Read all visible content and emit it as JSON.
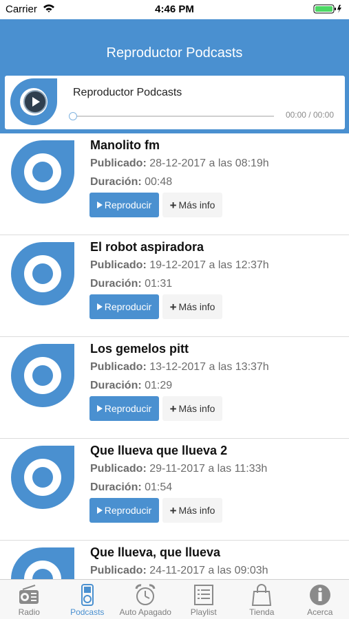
{
  "status_bar": {
    "carrier": "Carrier",
    "time": "4:46 PM"
  },
  "header": {
    "title": "Reproductor Podcasts"
  },
  "player": {
    "title": "Reproductor Podcasts",
    "time": "00:00 / 00:00",
    "progress": 0
  },
  "labels": {
    "published": "Publicado:",
    "duration": "Duración:",
    "play": "Reproducir",
    "more_info": "Más info"
  },
  "podcasts": [
    {
      "title": "Manolito fm",
      "published": "28-12-2017 a las 08:19h",
      "duration": "00:48"
    },
    {
      "title": "El robot aspiradora",
      "published": "19-12-2017 a las 12:37h",
      "duration": "01:31"
    },
    {
      "title": "Los gemelos pitt",
      "published": "13-12-2017 a las 13:37h",
      "duration": "01:29"
    },
    {
      "title": "Que llueva que llueva 2",
      "published": "29-11-2017 a las 11:33h",
      "duration": "01:54"
    },
    {
      "title": "Que llueva, que llueva",
      "published": "24-11-2017 a las 09:03h",
      "duration": ""
    }
  ],
  "tabs": [
    {
      "label": "Radio",
      "icon": "radio-icon"
    },
    {
      "label": "Podcasts",
      "icon": "ipod-icon",
      "active": true
    },
    {
      "label": "Auto Apagado",
      "icon": "alarm-clock-icon"
    },
    {
      "label": "Playlist",
      "icon": "list-icon"
    },
    {
      "label": "Tienda",
      "icon": "shopping-bag-icon"
    },
    {
      "label": "Acerca",
      "icon": "info-icon"
    }
  ],
  "colors": {
    "accent": "#4a90d0",
    "tab_inactive": "#7d7d7d",
    "battery": "#4cd964"
  }
}
